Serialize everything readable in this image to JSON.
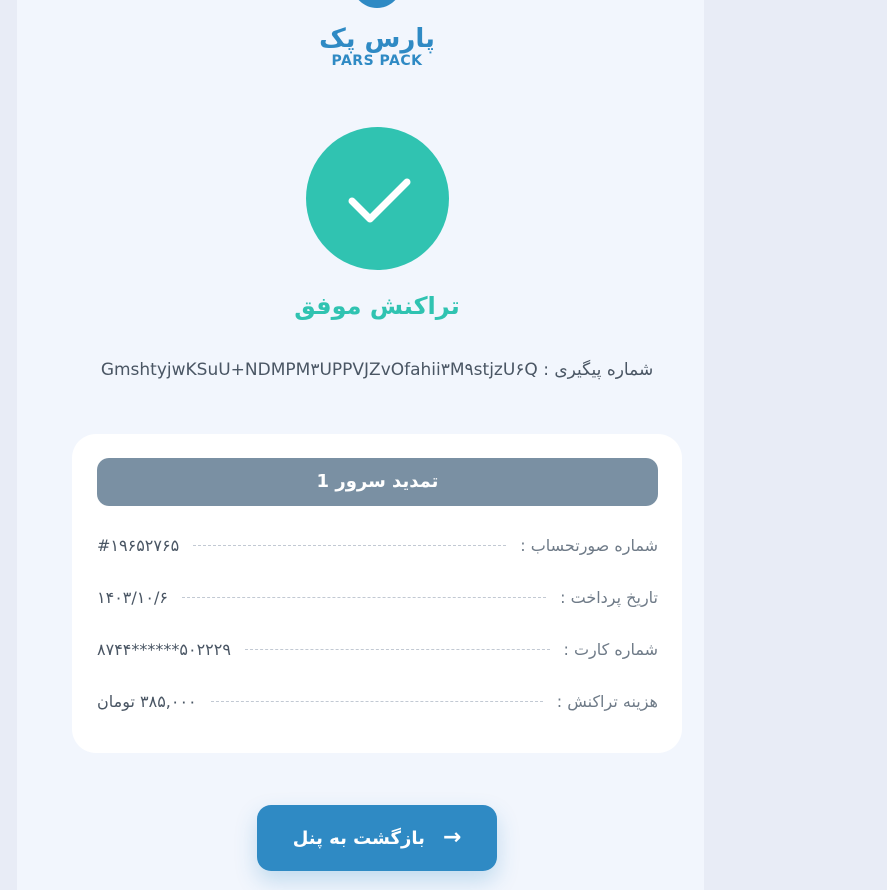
{
  "logo": {
    "text_fa": "پارس پک",
    "text_en": "PARS PACK",
    "color": "#2f8ac4"
  },
  "status": {
    "icon": "check-icon",
    "color": "#30c3b1",
    "title": "تراکنش موفق"
  },
  "tracking": {
    "label": "شماره پیگیری :",
    "code": "GmshtyjwKSuU+NDMPM۳UPPVJZvOfahii۳M۹stjzU۶Q"
  },
  "card": {
    "header": "تمدید سرور 1",
    "rows": [
      {
        "label": "شماره صورتحساب :",
        "value": "#۱۹۶۵۲۷۶۵"
      },
      {
        "label": "تاریخ پرداخت :",
        "value": "۱۴۰۳/۱۰/۶"
      },
      {
        "label": "شماره کارت :",
        "value": "۵۰۲۲۲۹******۸۷۴۴"
      },
      {
        "label": "هزینه تراکنش :",
        "value": "۳۸۵,۰۰۰ تومان"
      }
    ]
  },
  "back_button": {
    "label": "بازگشت به پنل",
    "icon": "arrow-right-icon"
  }
}
